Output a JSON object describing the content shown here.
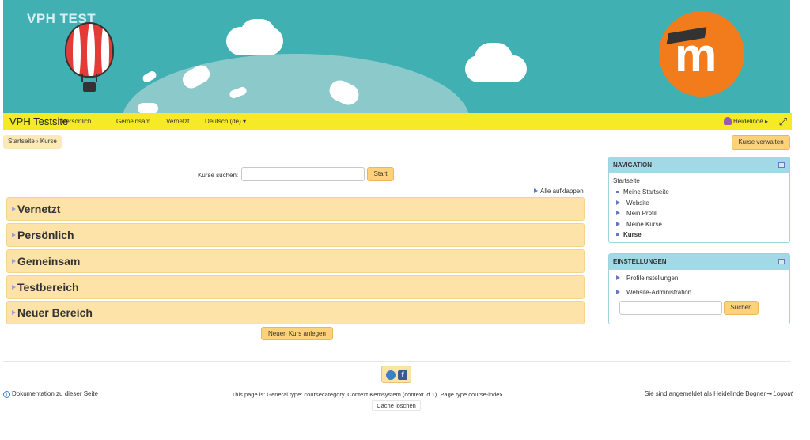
{
  "header": {
    "site_watermark": "VPH TEST",
    "brand": "VPH Testsite",
    "nav_items": [
      "Persönlich",
      "Gemeinsam",
      "Vernetzt",
      "Deutsch (de) ▾"
    ],
    "user": "Heidelinde ▸"
  },
  "breadcrumb": "Startseite  ›  Kurse",
  "manage_courses_label": "Kurse verwalten",
  "search": {
    "label": "Kurse suchen:",
    "value": "",
    "button": "Start"
  },
  "expand_all": "Alle aufklappen",
  "categories": [
    "Vernetzt",
    "Persönlich",
    "Gemeinsam",
    "Testbereich",
    "Neuer Bereich"
  ],
  "new_course_label": "Neuen Kurs anlegen",
  "navigation_block": {
    "title": "NAVIGATION",
    "root": "Startseite",
    "items": [
      "Meine Startseite",
      "Website",
      "Mein Profil",
      "Meine Kurse",
      "Kurse"
    ]
  },
  "settings_block": {
    "title": "EINSTELLUNGEN",
    "items": [
      "Profileinstellungen",
      "Website-Administration"
    ],
    "search_value": "",
    "search_button": "Suchen"
  },
  "footer": {
    "doc_link": "Dokumentation zu dieser Seite",
    "page_info": "This page is: General type: coursecategory. Context Kernsystem (context id 1). Page type course-index.",
    "cache_link": "Cache löschen",
    "logged_in_text": "Sie sind angemeldet als Heidelinde Bogner",
    "logout": "Logout"
  },
  "colors": {
    "banner": "#41b0b2",
    "navbar": "#f6e925",
    "category_bg": "#fde3a7",
    "button": "#fdd27a",
    "block_header": "#a3d9e7"
  }
}
